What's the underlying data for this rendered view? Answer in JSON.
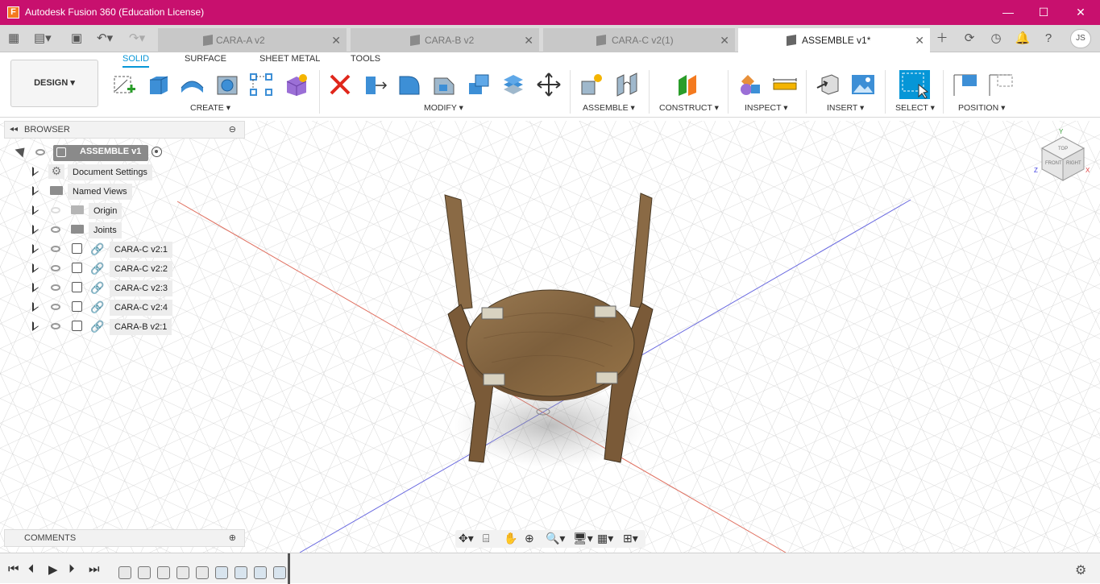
{
  "app": {
    "title": "Autodesk Fusion 360 (Education License)",
    "logo_letter": "F"
  },
  "window_controls": {
    "minimize": "—",
    "maximize": "☐",
    "close": "✕"
  },
  "tabs": [
    {
      "label": "CARA-A v2",
      "active": false
    },
    {
      "label": "CARA-B v2",
      "active": false
    },
    {
      "label": "CARA-C v2(1)",
      "active": false
    },
    {
      "label": "ASSEMBLE v1*",
      "active": true
    }
  ],
  "user": {
    "initials": "JS"
  },
  "workspace": {
    "label": "DESIGN"
  },
  "toolbar_tabs": [
    "SOLID",
    "SURFACE",
    "SHEET METAL",
    "TOOLS"
  ],
  "tool_groups": [
    "CREATE",
    "MODIFY",
    "ASSEMBLE",
    "CONSTRUCT",
    "INSPECT",
    "INSERT",
    "SELECT",
    "POSITION"
  ],
  "browser": {
    "title": "BROWSER",
    "root": "ASSEMBLE v1",
    "items": [
      {
        "label": "Document Settings",
        "type": "settings"
      },
      {
        "label": "Named Views",
        "type": "folder"
      },
      {
        "label": "Origin",
        "type": "folder"
      },
      {
        "label": "Joints",
        "type": "folder"
      },
      {
        "label": "CARA-C v2:1",
        "type": "component"
      },
      {
        "label": "CARA-C v2:2",
        "type": "component"
      },
      {
        "label": "CARA-C v2:3",
        "type": "component"
      },
      {
        "label": "CARA-C v2:4",
        "type": "component"
      },
      {
        "label": "CARA-B v2:1",
        "type": "component"
      }
    ]
  },
  "comments": {
    "title": "COMMENTS"
  },
  "viewcube": {
    "top": "TOP",
    "front": "FRONT",
    "right": "RIGHT",
    "x": "X",
    "y": "Y",
    "z": "Z"
  },
  "colors": {
    "titlebar": "#c8106e",
    "accent": "#0696d7",
    "wood": "#8a6a45"
  }
}
